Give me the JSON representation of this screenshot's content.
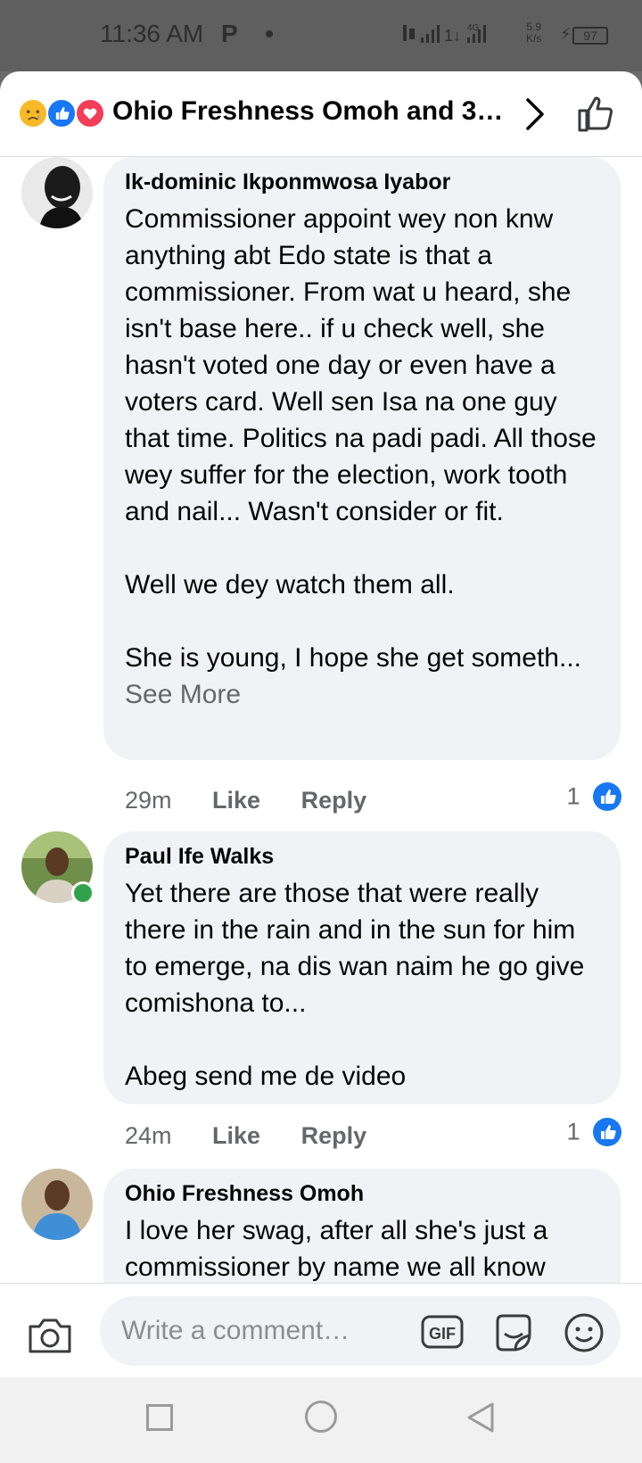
{
  "status_bar": {
    "time": "11:36 AM",
    "notification_glyph": "P",
    "network": "4G",
    "speed_value": "5.9",
    "speed_unit": "K/s",
    "battery": "97"
  },
  "header": {
    "reactions": [
      "sad-reaction-icon",
      "like-reaction-icon",
      "love-reaction-icon"
    ],
    "title": "Ohio Freshness Omoh and 3 ..."
  },
  "comments": [
    {
      "author": "Ik-dominic Ikponmwosa Iyabor",
      "text": "Commissioner appoint wey non knw anything abt Edo state is that a commissioner. From wat u heard, she isn't base here.. if u check well, she hasn't voted one day or even have a voters card. Well sen Isa na one guy that time. Politics na padi padi. All those wey suffer for the election, work tooth and nail... Wasn't consider or fit.\n\nWell we dey watch them all.\n\nShe is young, I hope she get someth...",
      "see_more": "See More",
      "time": "29m",
      "like_label": "Like",
      "reply_label": "Reply",
      "reaction_count": "1"
    },
    {
      "author": "Paul Ife Walks",
      "text": "Yet there are those that were really there in the rain and in the sun for him to emerge, na dis wan naim he go give comishona to...\n\nAbeg send me de video",
      "time": "24m",
      "like_label": "Like",
      "reply_label": "Reply",
      "reaction_count": "1"
    },
    {
      "author": "Ohio Freshness Omoh",
      "text": "I love her swag, after all she's just a commissioner by name we all know"
    }
  ],
  "composer": {
    "placeholder": "Write a comment…",
    "gif_label": "GIF"
  },
  "colors": {
    "facebook_blue": "#1877f2",
    "bubble_gray": "#f0f2f5",
    "secondary_text": "#65676b",
    "online_green": "#31a24c"
  }
}
